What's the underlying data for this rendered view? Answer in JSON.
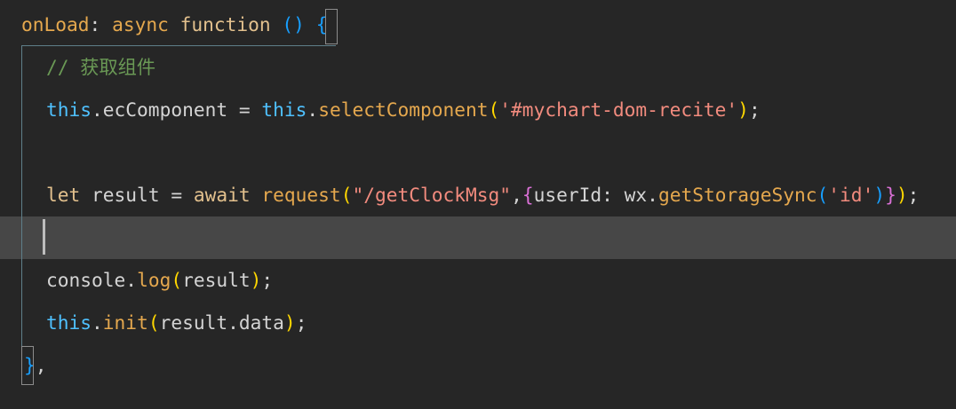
{
  "lines": {
    "l1": {
      "t1": "onLoad",
      "t2": ":",
      "t3": " async",
      "t4": " function",
      "t5": " ()",
      "t6": " {"
    },
    "l2": {
      "t1": "// 获取组件"
    },
    "l3": {
      "t1": "this",
      "t2": ".ecComponent",
      "t3": " = ",
      "t4": "this",
      "t5": ".",
      "t6": "selectComponent",
      "t7": "(",
      "t8": "'#mychart-dom-recite'",
      "t9": ")",
      "t10": ";"
    },
    "l4": {},
    "l5": {
      "t1": "let",
      "t2": " result",
      "t3": " = ",
      "t4": "await",
      "t5": " request",
      "t6": "(",
      "t7": "\"/getClockMsg\"",
      "t8": ",",
      "t9": "{",
      "t10": "userId",
      "t11": ": ",
      "t12": "wx",
      "t13": ".",
      "t14": "getStorageSync",
      "t15": "(",
      "t16": "'id'",
      "t17": ")",
      "t18": "}",
      "t19": ")",
      "t20": ";"
    },
    "l6": {},
    "l7": {
      "t1": "console",
      "t2": ".",
      "t3": "log",
      "t4": "(",
      "t5": "result",
      "t6": ")",
      "t7": ";"
    },
    "l8": {
      "t1": "this",
      "t2": ".",
      "t3": "init",
      "t4": "(",
      "t5": "result",
      "t6": ".data",
      "t7": ")",
      "t8": ";"
    },
    "l9": {
      "t1": "}",
      "t2": ","
    }
  },
  "colors": {
    "background": "#262626",
    "active_line": "#474747",
    "keyword": "#569cd6",
    "function_name": "#e5a84e",
    "string": "#f28b7e",
    "this": "#4fc1ff",
    "comment": "#6a9955",
    "bracket_level1": "#ffd700",
    "bracket_level2": "#da70d6",
    "bracket_level3": "#179fff"
  }
}
